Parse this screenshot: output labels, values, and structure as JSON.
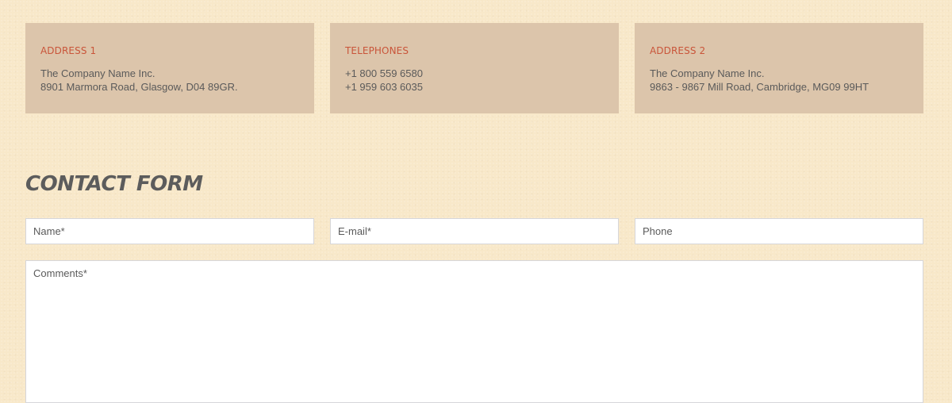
{
  "contact_info": {
    "address1": {
      "title": "ADDRESS 1",
      "line1": "The Company Name Inc.",
      "line2": "8901 Marmora Road, Glasgow, D04 89GR."
    },
    "telephones": {
      "title": "TELEPHONES",
      "line1": "+1 800 559 6580",
      "line2": "+1 959 603 6035"
    },
    "address2": {
      "title": "ADDRESS 2",
      "line1": "The Company Name Inc.",
      "line2": "9863 - 9867 Mill Road, Cambridge, MG09 99HT"
    }
  },
  "form": {
    "heading": "CONTACT FORM",
    "name_placeholder": "Name*",
    "email_placeholder": "E-mail*",
    "phone_placeholder": "Phone",
    "comments_placeholder": "Comments*"
  },
  "colors": {
    "page_background": "#f8e8c9",
    "info_box_background": "#dcc5ab",
    "info_title": "#c9553a",
    "body_text": "#5a5a5a",
    "heading_text": "#5c5c5c",
    "field_border": "#d6d6da"
  }
}
